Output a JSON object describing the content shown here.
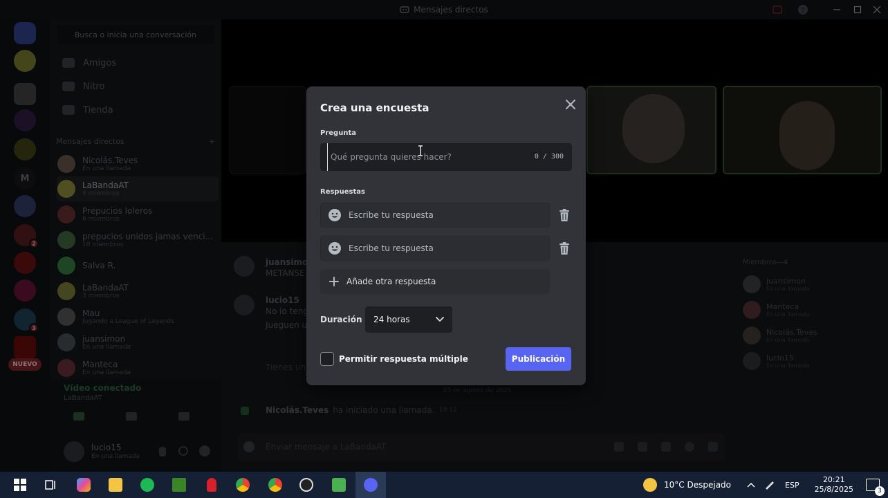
{
  "titlebar": {
    "title": "Mensajes directos"
  },
  "dm_sidebar": {
    "search_placeholder": "Busca o inicia una conversación",
    "nav": [
      {
        "label": "Amigos",
        "icon": "friends-icon"
      },
      {
        "label": "Nitro",
        "icon": "nitro-icon"
      },
      {
        "label": "Tienda",
        "icon": "store-icon"
      }
    ],
    "header": "Mensajes directos",
    "header_add": "+",
    "dms": [
      {
        "name": "Nicolás.Teves",
        "sub": "En una llamada",
        "color": "#5a4a40"
      },
      {
        "name": "LaBandaAT",
        "sub": "4 miembros",
        "color": "#7a7a30"
      },
      {
        "name": "Prepucios loleros",
        "sub": "6 miembros",
        "color": "#5a2a2a"
      },
      {
        "name": "prepucios unidos jamas venci...",
        "sub": "10 miembros",
        "color": "#3a5a3a"
      },
      {
        "name": "Salva R.",
        "sub": "",
        "color": "#2f6a3a"
      },
      {
        "name": "LaBandaAT",
        "sub": "3 miembros",
        "color": "#6a6a30"
      },
      {
        "name": "Mau",
        "sub": "Jugando a League of Legends",
        "color": "#4a4a4a"
      },
      {
        "name": "juansimon",
        "sub": "En una llamada",
        "color": "#404448"
      },
      {
        "name": "Manteca",
        "sub": "En una llamada",
        "color": "#5a2a30"
      }
    ],
    "new_badge": "NUEVO",
    "voice_status": "Vídeo conectado",
    "voice_channel": "LaBandaAT",
    "user": {
      "name": "lucio15",
      "status": "En una llamada"
    }
  },
  "chat": {
    "messages": [
      {
        "author": "juansimon",
        "text": "METANSE"
      },
      {
        "author": "lucio15",
        "text": "No lo teng"
      },
      {
        "author": "",
        "text": "Jueguen u"
      }
    ],
    "call_notice": "Tienes un",
    "date_divider": "25 de agosto de 2025",
    "call_started": {
      "author": "Nicolás.Teves",
      "text": "ha iniciado una llamada.",
      "time": "19:12"
    },
    "composer_placeholder": "Enviar mensaje a LaBandaAT"
  },
  "members": {
    "header": "Miembros—4",
    "list": [
      {
        "name": "juansimon",
        "status": "En una llamada"
      },
      {
        "name": "Manteca",
        "status": "En una llamada"
      },
      {
        "name": "Nicolás.Teves",
        "status": "En una llamada"
      },
      {
        "name": "lucio15",
        "status": "En una llamada"
      }
    ]
  },
  "poll_modal": {
    "title": "Crea una encuesta",
    "question_label": "Pregunta",
    "question_placeholder": "Qué pregunta quieres hacer?",
    "question_counter": "0 / 300",
    "answers_label": "Respuestas",
    "answers": [
      {
        "placeholder": "Escribe tu respuesta"
      },
      {
        "placeholder": "Escribe tu respuesta"
      }
    ],
    "add_answer_label": "Añade otra respuesta",
    "duration_label": "Duración",
    "duration_value": "24 horas",
    "multiple_label": "Permitir respuesta múltiple",
    "multiple_checked": false,
    "publish_label": "Publicación",
    "accent_color": "#5865f2"
  },
  "taskbar": {
    "weather": "10°C  Despejado",
    "lang": "ESP",
    "time": "20:21",
    "date": "25/8/2025",
    "notifications": "3"
  }
}
